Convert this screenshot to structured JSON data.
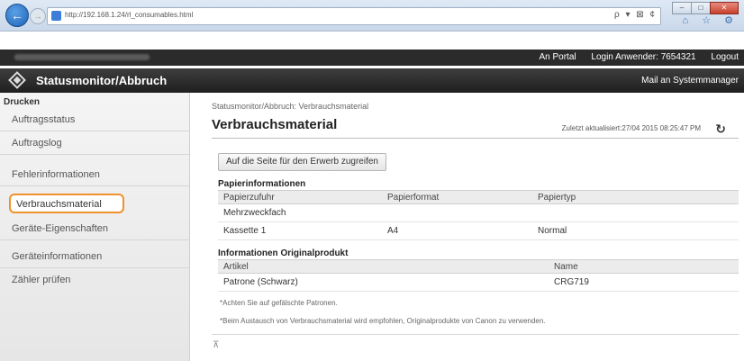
{
  "browser": {
    "url": "http://192.168.1.24/rl_consumables.html",
    "url_short": "http://192.168.1.24/rl_consumables.html",
    "addr_tools": "ρ ▾ ⊠ ¢",
    "right_icons": "⌂ ☆ ⚙"
  },
  "topbar": {
    "portal": "An Portal",
    "login_label": "Login Anwender:",
    "login_id": "7654321",
    "logout": "Logout"
  },
  "titlebar": {
    "app_title": "Statusmonitor/Abbruch",
    "mail_link": "Mail an Systemmanager"
  },
  "sidebar": {
    "heading": "Drucken",
    "items": [
      {
        "label": "Auftragsstatus"
      },
      {
        "label": "Auftragslog"
      },
      {
        "label": "Fehlerinformationen"
      },
      {
        "label": "Verbrauchsmaterial"
      },
      {
        "label": "Geräte-Eigenschaften"
      },
      {
        "label": "Geräteinformationen"
      },
      {
        "label": "Zähler prüfen"
      }
    ]
  },
  "main": {
    "breadcrumb": "Statusmonitor/Abbruch: Verbrauchsmaterial",
    "title": "Verbrauchsmaterial",
    "last_updated": "Zuletzt aktualisiert:27/04 2015 08:25:47 PM",
    "buy_button": "Auf die Seite für den Erwerb zugreifen",
    "paper": {
      "heading": "Papierinformationen",
      "headers": [
        "Papierzufuhr",
        "Papierformat",
        "Papiertyp"
      ],
      "rows": [
        [
          "Mehrzweckfach",
          "",
          ""
        ],
        [
          "Kassette 1",
          "A4",
          "Normal"
        ]
      ]
    },
    "original": {
      "heading": "Informationen Originalprodukt",
      "headers": [
        "Artikel",
        "Name"
      ],
      "rows": [
        [
          "Patrone (Schwarz)",
          "CRG719"
        ]
      ]
    },
    "note1": "*Achten Sie auf gefälschte Patronen.",
    "note2": "*Beim Austausch von Verbrauchsmaterial wird empfohlen, Originalprodukte von Canon zu verwenden.",
    "top_link": "⊼"
  }
}
